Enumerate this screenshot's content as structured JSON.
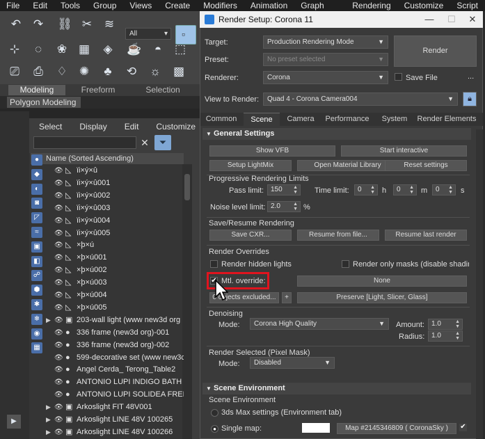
{
  "menubar": [
    "File",
    "Edit",
    "Tools",
    "Group",
    "Views",
    "Create",
    "Modifiers",
    "Animation",
    "Graph Editors",
    "Rendering",
    "Customize",
    "Script"
  ],
  "toolbar": {
    "selection_filter": "All"
  },
  "ribbon": {
    "tabs": [
      "Modeling",
      "Freeform",
      "Selection"
    ],
    "panel_title": "Polygon Modeling"
  },
  "scene_explorer": {
    "menu": [
      "Select",
      "Display",
      "Edit",
      "Customize"
    ],
    "column_header": "Name (Sorted Ascending)",
    "rows": [
      {
        "name": "ïi×ý×û",
        "expand": false,
        "icon": "bone"
      },
      {
        "name": "ïi×ý×û001",
        "expand": false,
        "icon": "bone"
      },
      {
        "name": "ïi×ý×û002",
        "expand": false,
        "icon": "bone"
      },
      {
        "name": "ïi×ý×û003",
        "expand": false,
        "icon": "bone"
      },
      {
        "name": "ïi×ý×û004",
        "expand": false,
        "icon": "bone"
      },
      {
        "name": "ïi×ý×û005",
        "expand": false,
        "icon": "bone"
      },
      {
        "name": "×þ×ú",
        "expand": false,
        "icon": "bone"
      },
      {
        "name": "×þ×ú001",
        "expand": false,
        "icon": "bone"
      },
      {
        "name": "×þ×ú002",
        "expand": false,
        "icon": "bone"
      },
      {
        "name": "×þ×ú003",
        "expand": false,
        "icon": "bone"
      },
      {
        "name": "×þ×ú004",
        "expand": false,
        "icon": "bone"
      },
      {
        "name": "×þ×ú005",
        "expand": false,
        "icon": "bone"
      },
      {
        "name": "203-wall light  (www new3d org",
        "expand": true,
        "icon": "group"
      },
      {
        "name": "336 frame (new3d org)-001",
        "expand": false,
        "icon": "sphere"
      },
      {
        "name": "336 frame (new3d org)-002",
        "expand": false,
        "icon": "sphere"
      },
      {
        "name": "599-decorative set (www new3c",
        "expand": false,
        "icon": "sphere"
      },
      {
        "name": "Angel Cerda_ Terong_Table2",
        "expand": false,
        "icon": "sphere"
      },
      {
        "name": "ANTONIO LUPI INDIGO BATH MD",
        "expand": false,
        "icon": "sphere"
      },
      {
        "name": "ANTONIO LUPI SOLIDEA FREEST",
        "expand": false,
        "icon": "sphere"
      },
      {
        "name": "Arkoslight FIT 48V001",
        "expand": true,
        "icon": "group"
      },
      {
        "name": "Arkoslight LINE 48V 100265",
        "expand": true,
        "icon": "group"
      },
      {
        "name": "Arkoslight LINE 48V 100266",
        "expand": true,
        "icon": "group"
      }
    ]
  },
  "dialog": {
    "title": "Render Setup: Corona 11",
    "target_label": "Target:",
    "target_value": "Production Rendering Mode",
    "preset_label": "Preset:",
    "preset_value": "No preset selected",
    "renderer_label": "Renderer:",
    "renderer_value": "Corona",
    "save_file_label": "Save File",
    "more": "...",
    "render_button": "Render",
    "view_label": "View to Render:",
    "view_value": "Quad 4 - Corona Camera004",
    "tabs": [
      "Common",
      "Scene",
      "Camera",
      "Performance",
      "System",
      "Render Elements"
    ],
    "general_settings": {
      "title": "General Settings",
      "show_vfb": "Show VFB",
      "start_interactive": "Start interactive",
      "setup_lightmix": "Setup LightMix",
      "open_material_library": "Open Material Library",
      "reset_settings": "Reset settings",
      "progressive_title": "Progressive Rendering Limits",
      "pass_limit_label": "Pass limit:",
      "pass_limit_value": "150",
      "time_limit_label": "Time limit:",
      "time_h": "0",
      "time_m": "0",
      "time_s": "0",
      "unit_h": "h",
      "unit_m": "m",
      "unit_s": "s",
      "noise_label": "Noise level limit:",
      "noise_value": "2.0",
      "noise_unit": "%",
      "save_resume_title": "Save/Resume Rendering",
      "save_cxr": "Save CXR...",
      "resume_from_file": "Resume from file...",
      "resume_last": "Resume last render",
      "overrides_title": "Render Overrides",
      "render_hidden_lights": "Render hidden lights",
      "render_only_masks": "Render only masks (disable shading",
      "mtl_override": "Mtl. override:",
      "mtl_override_checked": "✔",
      "mtl_none": "None",
      "objects_excluded": "0 objects excluded...",
      "plus": "+",
      "preserve": "Preserve [Light, Slicer, Glass]",
      "denoising_title": "Denoising",
      "mode_label": "Mode:",
      "denoise_mode": "Corona High Quality",
      "amount_label": "Amount:",
      "amount_value": "1.0",
      "radius_label": "Radius:",
      "radius_value": "1.0",
      "render_selected_title": "Render Selected (Pixel Mask)",
      "render_selected_mode": "Disabled"
    },
    "scene_environment": {
      "title": "Scene Environment",
      "group": "Scene Environment",
      "opt_3dsmax": "3ds Max settings (Environment tab)",
      "opt_single_map": "Single map:",
      "map_name": "Map #2145346809  ( CoronaSky )"
    }
  },
  "colors": {
    "highlight_box": "#e0141e",
    "accent": "#9fc3e8"
  }
}
